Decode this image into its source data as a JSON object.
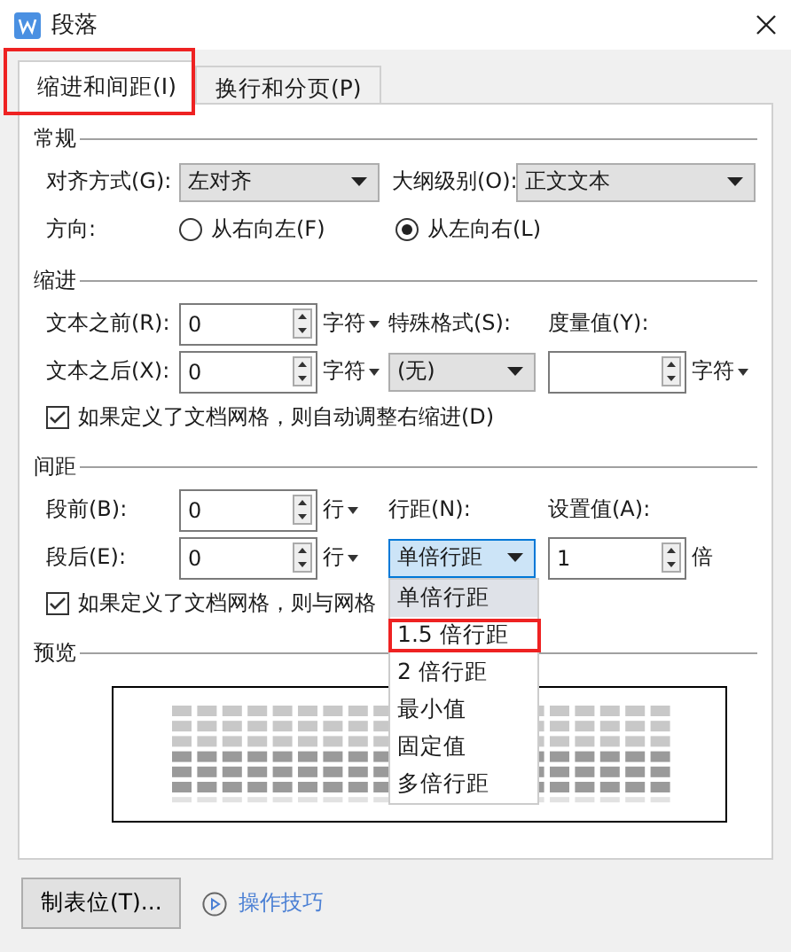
{
  "window": {
    "title": "段落"
  },
  "tabs": [
    {
      "label": "缩进和间距(I)",
      "selected": true,
      "highlighted": true
    },
    {
      "label": "换行和分页(P)",
      "selected": false,
      "highlighted": false
    }
  ],
  "general": {
    "title": "常规",
    "alignment": {
      "label": "对齐方式(G):",
      "value": "左对齐"
    },
    "outline_level": {
      "label": "大纲级别(O):",
      "value": "正文文本"
    },
    "direction": {
      "label": "方向:",
      "options": [
        {
          "label": "从右向左(F)",
          "selected": false
        },
        {
          "label": "从左向右(L)",
          "selected": true
        }
      ]
    }
  },
  "indent": {
    "title": "缩进",
    "before": {
      "label": "文本之前(R):",
      "value": "0",
      "unit": "字符"
    },
    "after": {
      "label": "文本之后(X):",
      "value": "0",
      "unit": "字符"
    },
    "special": {
      "label": "特殊格式(S):",
      "value": "(无)"
    },
    "measure": {
      "label": "度量值(Y):",
      "unit": "字符"
    },
    "auto_adjust": {
      "label": "如果定义了文档网格，则自动调整右缩进(D)",
      "checked": true
    }
  },
  "spacing": {
    "title": "间距",
    "before": {
      "label": "段前(B):",
      "value": "0",
      "unit": "行"
    },
    "after": {
      "label": "段后(E):",
      "value": "0",
      "unit": "行"
    },
    "line_spacing": {
      "label": "行距(N):",
      "value": "单倍行距",
      "expanded": true,
      "options": [
        {
          "label": "单倍行距",
          "selected": true,
          "highlighted": false
        },
        {
          "label": "1.5 倍行距",
          "selected": false,
          "highlighted": true
        },
        {
          "label": "2 倍行距",
          "selected": false,
          "highlighted": false
        },
        {
          "label": "最小值",
          "selected": false,
          "highlighted": false
        },
        {
          "label": "固定值",
          "selected": false,
          "highlighted": false
        },
        {
          "label": "多倍行距",
          "selected": false,
          "highlighted": false
        }
      ]
    },
    "set_value": {
      "label": "设置值(A):",
      "value": "1",
      "unit": "倍"
    },
    "snap_to_grid": {
      "label": "如果定义了文档网格，则与网格",
      "checked": true
    }
  },
  "preview": {
    "title": "预览"
  },
  "footer": {
    "tabs_button": "制表位(T)...",
    "tips_link": "操作技巧"
  }
}
